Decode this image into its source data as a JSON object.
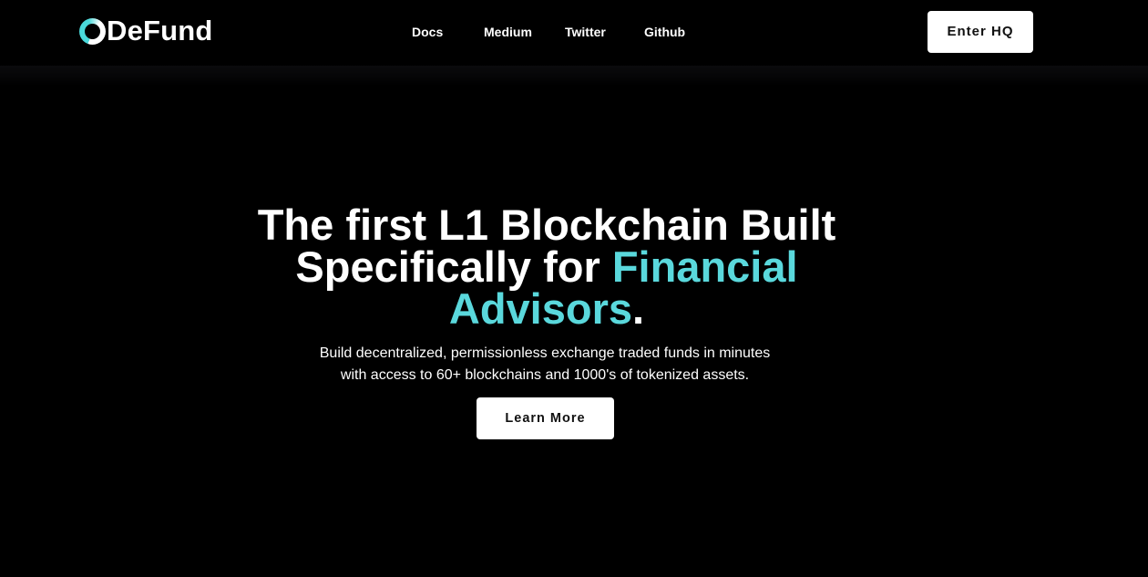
{
  "header": {
    "logo_text": "DeFund",
    "nav": {
      "docs": "Docs",
      "medium": "Medium",
      "twitter": "Twitter",
      "github": "Github"
    },
    "enter_label": "Enter HQ"
  },
  "hero": {
    "title_part1": "The first L1 Blockchain Built Specifically for ",
    "title_accent": "Financial Advisors",
    "title_end": ".",
    "subtitle_line1": "Build decentralized, permissionless exchange traded funds in minutes",
    "subtitle_line2": "with access to 60+ blockchains and 1000's of tokenized assets.",
    "cta_label": "Learn More"
  },
  "colors": {
    "background": "#000000",
    "accent": "#5ad8dc",
    "button_bg": "#ffffff",
    "button_text": "#111111"
  },
  "icons": {
    "logo": "defund-ring-logo-icon"
  }
}
